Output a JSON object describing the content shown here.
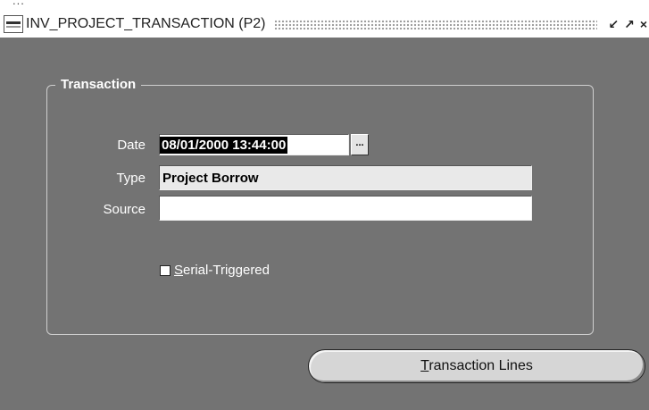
{
  "window": {
    "title": "INV_PROJECT_TRANSACTION (P2)",
    "top_cut_text": "..."
  },
  "group": {
    "title": "Transaction"
  },
  "fields": {
    "date": {
      "label": "Date",
      "value": "08/01/2000 13:44:00",
      "lov_label": "..."
    },
    "type": {
      "label": "Type",
      "value": "Project Borrow"
    },
    "source": {
      "label": "Source",
      "value": ""
    }
  },
  "checkbox": {
    "label_mnemonic": "S",
    "label_rest": "erial-Triggered",
    "checked": false
  },
  "buttons": {
    "transaction_lines_mnemonic": "T",
    "transaction_lines_rest": "ransaction Lines"
  },
  "colors": {
    "background": "#737373",
    "titlebar": "#ffffff",
    "text_on_bg": "#ffffff"
  }
}
